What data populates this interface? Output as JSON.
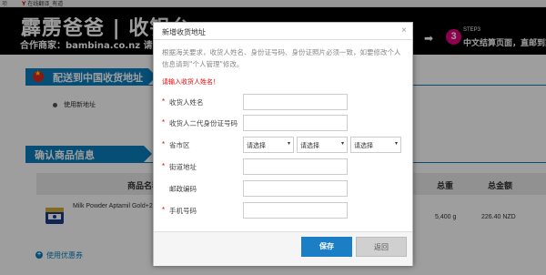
{
  "browser_bar": {
    "left_text": "项",
    "translate_label": "在线翻译_有道"
  },
  "header": {
    "brand": "霹雳爸爸 | 收银台",
    "merchant": "合作商家：bambina.co.nz 请完成付款",
    "steps_arrow": "➡",
    "step_number": "3",
    "step_label": "STEP3",
    "step_text": "中文结算页面，直邮到家"
  },
  "section_address": {
    "title": "配送到中国收货地址",
    "radio_label": "使用新地址"
  },
  "section_products": {
    "title": "确认商品信息",
    "columns": {
      "name": "商品名称",
      "weight": "总重",
      "total": "总金额"
    },
    "rows": [
      {
        "name": "Milk Powder Aptamil Gold+2 F",
        "weight": "5,400 g",
        "total": "226.40 NZD"
      }
    ],
    "coupon_label": "使用优惠券",
    "coupon_icon": "plus-icon"
  },
  "modal": {
    "title": "新增收货地址",
    "close_glyph": "×",
    "note": "根据海关要求，收货人姓名、身份证号码、身份证照片必须一致，如要修改个人信息请到\"个人管理\"修改。",
    "error": "请输入收货人姓名！",
    "fields": {
      "name": {
        "label": "收货人姓名",
        "value": ""
      },
      "id_number": {
        "label": "收货人二代身份证号码",
        "value": ""
      },
      "region": {
        "label": "省市区",
        "options": [
          "请选择",
          "请选择",
          "请选择"
        ]
      },
      "street": {
        "label": "街道地址",
        "value": ""
      },
      "postcode": {
        "label": "邮政编码",
        "value": ""
      },
      "phone": {
        "label": "手机号码",
        "value": ""
      }
    },
    "required_mark": "*",
    "save_label": "保存",
    "back_label": "返回"
  },
  "colors": {
    "header_bg": "#000000",
    "section_blue": "#0a7fbf",
    "step_magenta": "#e6007e",
    "save_blue": "#1c7fc6",
    "error_red": "#e00000"
  }
}
